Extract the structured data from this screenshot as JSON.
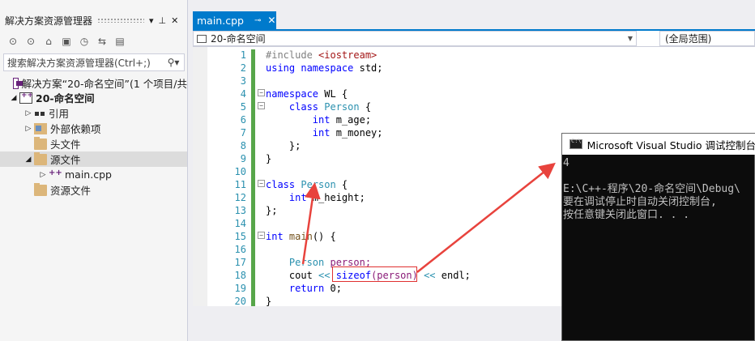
{
  "solution_explorer": {
    "title": "解决方案资源管理器",
    "title_controls": [
      "▾",
      "⊥",
      "✕"
    ],
    "search_placeholder": "搜索解决方案资源管理器(Ctrl+;)",
    "search_icon": "search-icon",
    "tree": [
      {
        "label": "解决方案“20-命名空间”(1 个项目/共",
        "icon": "solution-icon",
        "arrow": "",
        "indent": 0
      },
      {
        "label": "20-命名空间",
        "icon": "project-icon",
        "arrow": "◢",
        "indent": 0
      },
      {
        "label": "引用",
        "icon": "references-icon",
        "arrow": "▷",
        "indent": 1
      },
      {
        "label": "外部依赖项",
        "icon": "external-deps-icon",
        "arrow": "▷",
        "indent": 1
      },
      {
        "label": "头文件",
        "icon": "folder-icon",
        "arrow": "",
        "indent": 1
      },
      {
        "label": "源文件",
        "icon": "folder-open-icon",
        "arrow": "◢",
        "indent": 1
      },
      {
        "label": "main.cpp",
        "icon": "cpp-file-icon",
        "arrow": "▷",
        "indent": 2
      },
      {
        "label": "资源文件",
        "icon": "folder-icon",
        "arrow": "",
        "indent": 1
      }
    ]
  },
  "editor": {
    "tab_label": "main.cpp",
    "tab_pin": "⊸",
    "tab_close": "✕",
    "nav_scope": "20-命名空间",
    "nav_global": "(全局范围)",
    "line_numbers": [
      "1",
      "2",
      "3",
      "4",
      "5",
      "6",
      "7",
      "8",
      "9",
      "10",
      "11",
      "12",
      "13",
      "14",
      "15",
      "16",
      "17",
      "18",
      "19",
      "20"
    ],
    "code": {
      "l1_a": "#include ",
      "l1_b": "<iostream>",
      "l2_a": "using",
      "l2_b": " namespace",
      "l2_c": " std;",
      "l4_a": "namespace",
      "l4_b": " WL {",
      "l5_a": "    class",
      "l5_b": " Person",
      "l5_c": " {",
      "l6_a": "        int",
      "l6_b": " m_age;",
      "l7_a": "        int",
      "l7_b": " m_money;",
      "l8": "    };",
      "l9": "}",
      "l11_a": "class",
      "l11_b": " Person",
      "l11_c": " {",
      "l12_a": "    int",
      "l12_b": " m_height;",
      "l13": "};",
      "l15_a": "int",
      "l15_b": " main",
      "l15_c": "() {",
      "l17_a": "    Person",
      "l17_b": " person;",
      "l18_a": "    cout",
      "l18_b": " <<",
      "l18_c": " sizeof",
      "l18_d": "(person)",
      "l18_e": " <<",
      "l18_f": " endl;",
      "l19_a": "    return",
      "l19_b": " 0;",
      "l20": "}"
    }
  },
  "console": {
    "title": "Microsoft Visual Studio 调试控制台",
    "lines": [
      "4",
      "",
      "E:\\C++-程序\\20-命名空间\\Debug\\",
      "要在调试停止时自动关闭控制台,",
      "按任意键关闭此窗口. . ."
    ]
  },
  "colors": {
    "accent": "#007acc",
    "arrow": "#e8433d",
    "change_bar": "#57a64a"
  }
}
